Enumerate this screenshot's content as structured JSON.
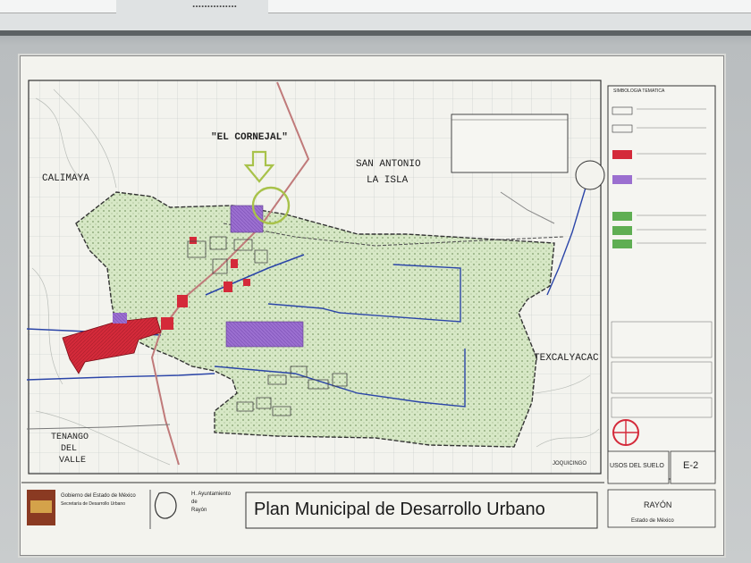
{
  "browser": {
    "tab_label": "...............",
    "colors": {
      "bar": "#dfe2e3"
    }
  },
  "map": {
    "places": {
      "el_cornejal": "\"EL CORNEJAL\"",
      "calimaya": "CALIMAYA",
      "san_antonio": "SAN ANTONIO",
      "la_isla": "LA ISLA",
      "texcalyacac": "TEXCALYACAC",
      "tenango_1": "TENANGO",
      "tenango_2": "DEL",
      "tenango_3": "VALLE",
      "joquicingo": "JOQUICINGO"
    },
    "colors": {
      "urban_red": "#d42a3a",
      "industrial_purple": "#9b6fd0",
      "green_zone": "#c9e3b0",
      "road_blue": "#2b45a8",
      "arrow_green": "#a8c24a"
    },
    "icons": [
      "north-arrow-icon",
      "highlight-arrow-icon"
    ]
  },
  "legend": {
    "title": "SIMBOLOGIA TEMATICA",
    "stamp_left": "USOS DEL SUELO",
    "stamp_right": "E-2"
  },
  "footer": {
    "gov_line1": "Gobierno del Estado de México",
    "gov_line2": "Secretaría de Desarrollo Urbano",
    "ayunt_line1": "H. Ayuntamiento",
    "ayunt_line2": "de",
    "ayunt_line3": "Rayón",
    "plan_title": "Plan Municipal de Desarrollo Urbano",
    "municipality": "RAYÓN",
    "state": "Estado de México"
  }
}
